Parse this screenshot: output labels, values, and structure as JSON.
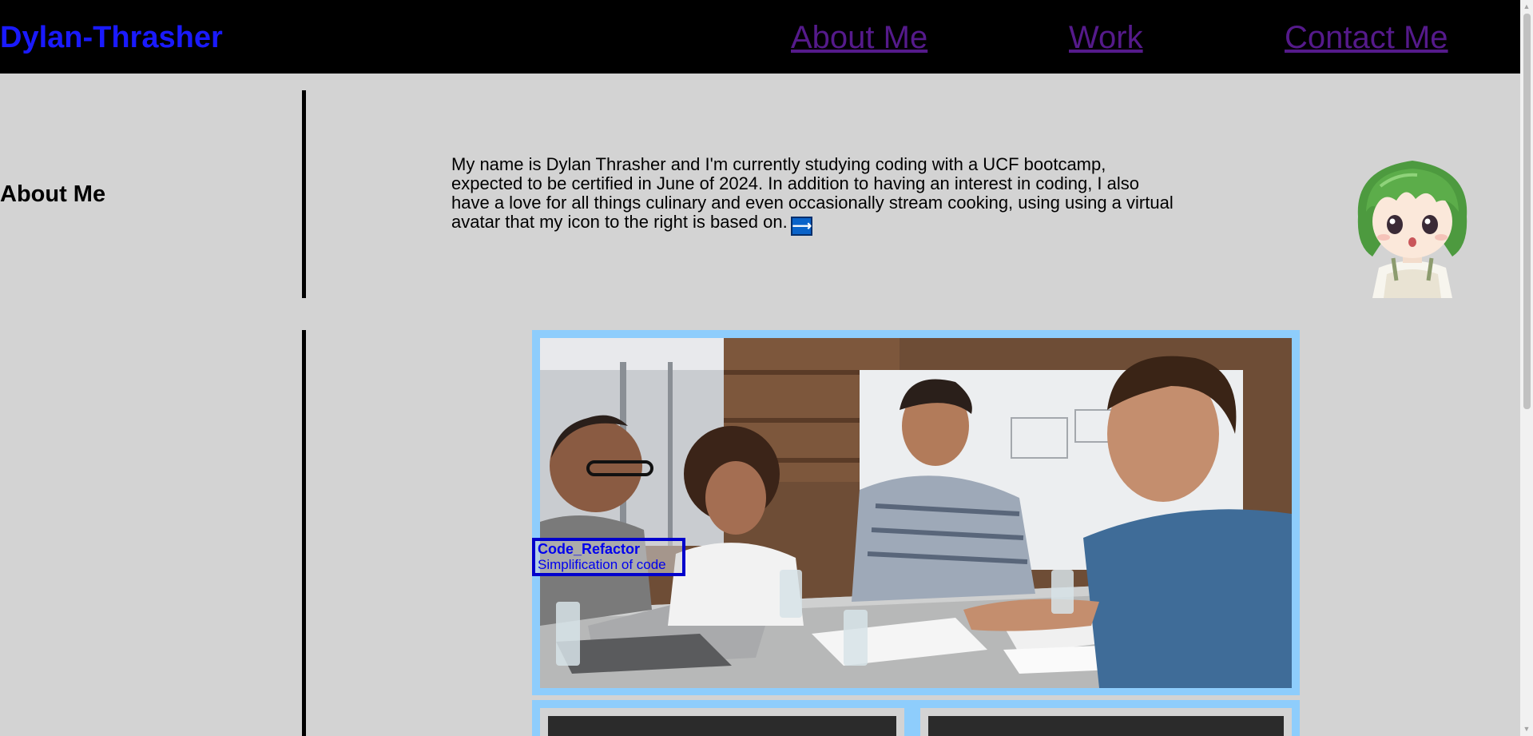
{
  "header": {
    "brand": "Dylan-Thrasher",
    "nav": [
      {
        "label": "About Me"
      },
      {
        "label": "Work"
      },
      {
        "label": "Contact Me"
      }
    ],
    "link_color": "#551a8b",
    "brand_color": "#1a1aff"
  },
  "about": {
    "title": "About Me",
    "bio": "My name is Dylan Thrasher and I'm currently studying coding with a UCF bootcamp, expected to be certified in June of 2024. In addition to having an interest in coding, I also have a love for all things culinary and even occasionally stream cooking, using using a virtual avatar that my icon to the right is based on.",
    "arrow_icon": "right-arrow-icon",
    "avatar_icon": "chibi-avatar-green-hair"
  },
  "work": {
    "projects": [
      {
        "title": "Code_Refactor",
        "subtitle": "Simplification of code",
        "image": "team-meeting-photo"
      }
    ],
    "card_border_color": "#8ecdfc"
  },
  "colors": {
    "background": "#d3d3d3",
    "header": "#000000"
  }
}
